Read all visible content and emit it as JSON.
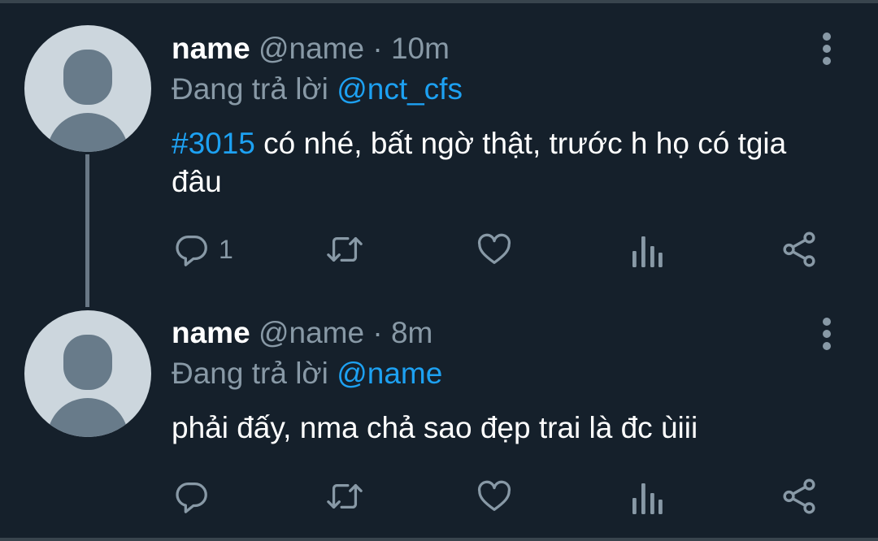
{
  "tweets": [
    {
      "display_name": "name",
      "handle": "@name",
      "separator": "·",
      "time": "10m",
      "reply_prefix": "Đang trả lời",
      "reply_to": "@nct_cfs",
      "hashtag": "#3015",
      "text": " có nhé, bất ngờ thật, trước h họ có tgia đâu",
      "reply_count": "1"
    },
    {
      "display_name": "name",
      "handle": "@name",
      "separator": "·",
      "time": "8m",
      "reply_prefix": "Đang trả lời",
      "reply_to": "@name",
      "text": "phải đấy, nma chả sao đẹp trai là đc ùiii",
      "reply_count": ""
    }
  ],
  "icons": {
    "reply": "reply-icon",
    "retweet": "retweet-icon",
    "like": "heart-icon",
    "analytics": "analytics-icon",
    "share": "share-icon",
    "more": "more-vertical-icon"
  },
  "colors": {
    "background": "#15202b",
    "accent": "#1da1f2",
    "secondary_text": "#8899a6",
    "avatar_bg": "#ccd6dd",
    "avatar_fg": "#687b8a"
  }
}
